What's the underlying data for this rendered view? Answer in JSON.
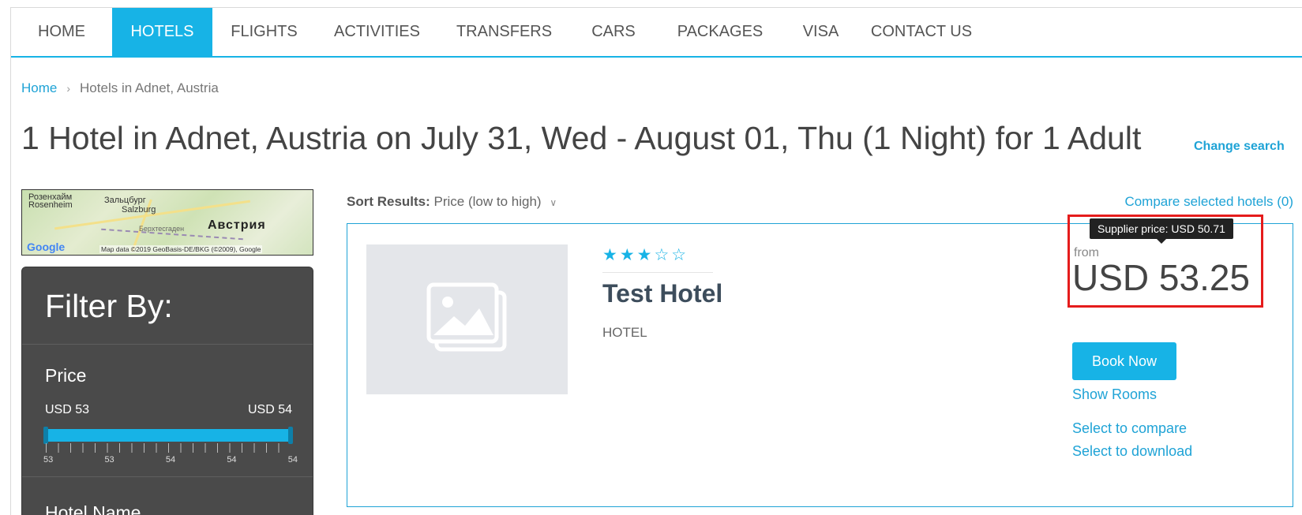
{
  "nav": {
    "items": [
      {
        "label": "HOME"
      },
      {
        "label": "HOTELS"
      },
      {
        "label": "FLIGHTS"
      },
      {
        "label": "ACTIVITIES"
      },
      {
        "label": "TRANSFERS"
      },
      {
        "label": "CARS"
      },
      {
        "label": "PACKAGES"
      },
      {
        "label": "VISA"
      },
      {
        "label": "CONTACT US"
      }
    ],
    "active": "HOTELS"
  },
  "breadcrumb": {
    "home": "Home",
    "current": "Hotels in Adnet, Austria"
  },
  "page_title": "1 Hotel in Adnet, Austria on July 31, Wed - August 01, Thu (1 Night) for 1 Adult",
  "change_search": "Change search",
  "map": {
    "labels": {
      "rosenheim_ru": "Розенхайм",
      "rosenheim": "Rosenheim",
      "salzburg_ru": "Зальцбург",
      "salzburg": "Salzburg",
      "berchtesgaden_ru": "Берхтесгаден",
      "austria_ru": "Австрия"
    },
    "attribution": "Map data ©2019 GeoBasis-DE/BKG (©2009), Google",
    "logo": "Google"
  },
  "filter": {
    "title": "Filter By:",
    "price_label": "Price",
    "price_min": "USD 53",
    "price_max": "USD 54",
    "tick_labels": [
      "53",
      "53",
      "54",
      "54",
      "54"
    ],
    "hotel_name_label": "Hotel Name"
  },
  "sort": {
    "label": "Sort Results:",
    "value": "Price (low to high)"
  },
  "compare_selected": "Compare selected hotels (0)",
  "hotel": {
    "stars_filled": 3,
    "stars_total": 5,
    "stars_display": "★★★☆☆",
    "name": "Test Hotel",
    "type": "HOTEL",
    "from_label": "from",
    "price": "USD 53.25",
    "supplier_tooltip": "Supplier price: USD 50.71",
    "book_label": "Book Now",
    "show_rooms": "Show Rooms",
    "select_compare": "Select to compare",
    "select_download": "Select to download"
  },
  "colors": {
    "accent": "#17b3e6",
    "link": "#1fa3d6",
    "highlight": "#e51c1c",
    "filter_bg": "#4a4a4a"
  }
}
